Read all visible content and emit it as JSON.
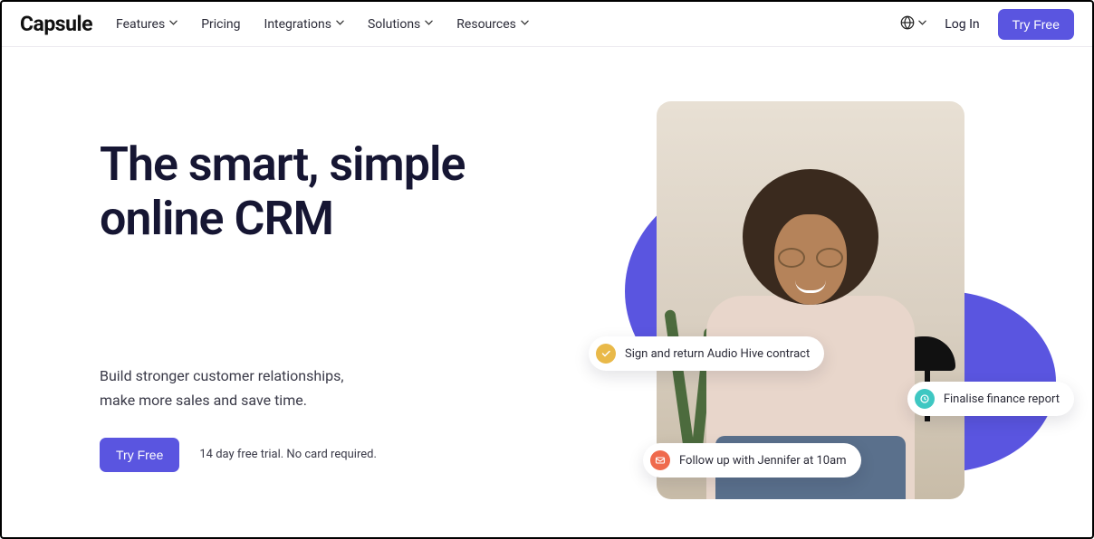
{
  "brand": {
    "name": "Capsule"
  },
  "nav": {
    "items": [
      {
        "label": "Features",
        "has_dropdown": true
      },
      {
        "label": "Pricing",
        "has_dropdown": false
      },
      {
        "label": "Integrations",
        "has_dropdown": true
      },
      {
        "label": "Solutions",
        "has_dropdown": true
      },
      {
        "label": "Resources",
        "has_dropdown": true
      }
    ],
    "login_label": "Log In",
    "cta_label": "Try Free"
  },
  "hero": {
    "headline": "The smart, simple online CRM",
    "subhead_line1": "Build stronger customer relationships,",
    "subhead_line2": "make more sales and save time.",
    "cta_label": "Try Free",
    "trial_note": "14 day free trial. No card required."
  },
  "tasks": [
    {
      "icon": "check",
      "text": "Sign and return Audio Hive contract"
    },
    {
      "icon": "clock",
      "text": "Finalise finance report"
    },
    {
      "icon": "mail",
      "text": "Follow up with Jennifer at 10am"
    }
  ],
  "colors": {
    "primary": "#5a55e0",
    "check_icon_bg": "#e9b949",
    "clock_icon_bg": "#3ec7c2",
    "mail_icon_bg": "#ef6a4d"
  }
}
